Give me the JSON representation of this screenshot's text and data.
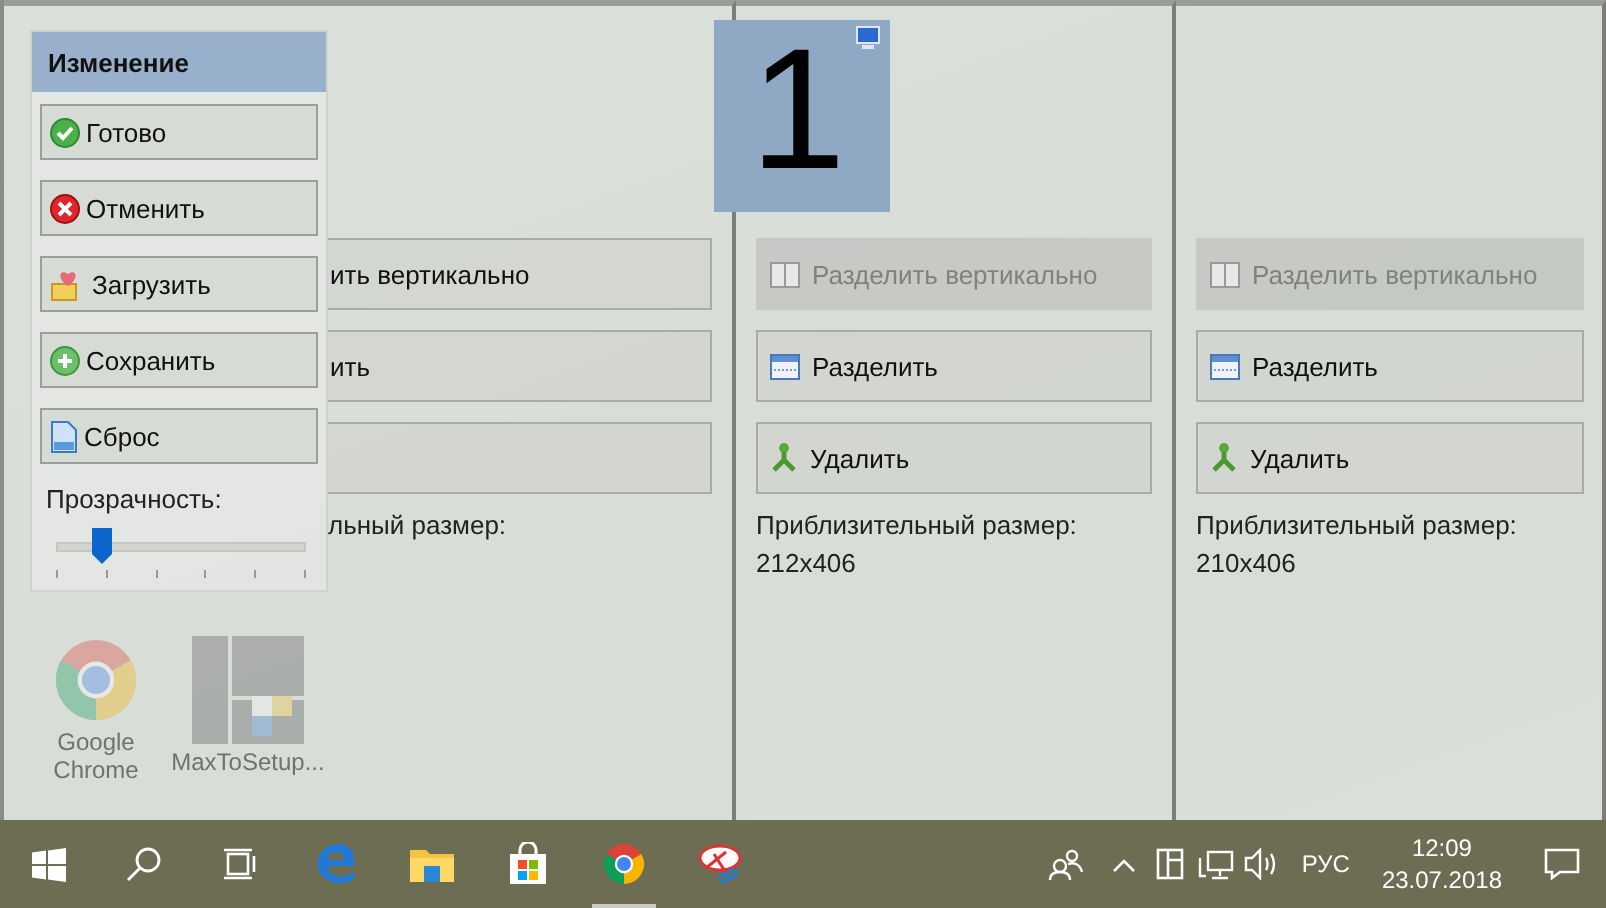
{
  "desktop_icons": [
    {
      "label": "Google Chrome",
      "kind": "chrome"
    },
    {
      "label": "MaxToSetup...",
      "kind": "windows-grid"
    }
  ],
  "panes": [
    {
      "covered": true,
      "buttons": [
        {
          "label": "ить вертикально",
          "kind": "split-vertical",
          "disabled": false
        },
        {
          "label": "ить",
          "kind": "split",
          "disabled": false
        },
        {
          "kind": "delete",
          "disabled": false
        }
      ],
      "size_label": "льный размер:"
    },
    {
      "covered": false,
      "buttons": [
        {
          "label": "Разделить вертикально",
          "kind": "split-vertical",
          "disabled": true
        },
        {
          "label": "Разделить",
          "kind": "split",
          "disabled": false
        },
        {
          "label": "Удалить",
          "kind": "delete",
          "disabled": false
        }
      ],
      "size_label": "Приблизительный размер:",
      "size": "212x406"
    },
    {
      "covered": false,
      "buttons": [
        {
          "label": "Разделить вертикально",
          "kind": "split-vertical",
          "disabled": true
        },
        {
          "label": "Разделить",
          "kind": "split",
          "disabled": false
        },
        {
          "label": "Удалить",
          "kind": "delete",
          "disabled": false
        }
      ],
      "size_label": "Приблизительный размер:",
      "size": "210x406"
    }
  ],
  "monitor_badge": {
    "number": "1"
  },
  "edit_panel": {
    "title": "Изменение",
    "buttons": [
      {
        "label": "Готово",
        "kind": "done"
      },
      {
        "label": "Отменить",
        "kind": "cancel"
      },
      {
        "label": "Загрузить",
        "kind": "load"
      },
      {
        "label": "Сохранить",
        "kind": "save"
      },
      {
        "label": "Сброс",
        "kind": "reset"
      }
    ],
    "opacity_label": "Прозрачность:",
    "opacity": {
      "level": 0.18
    }
  },
  "taskbar": {
    "apps": [
      {
        "kind": "edge",
        "running": false
      },
      {
        "kind": "explorer",
        "running": false
      },
      {
        "kind": "store",
        "running": false
      },
      {
        "kind": "chrome",
        "running": true
      },
      {
        "kind": "snipping",
        "running": false
      }
    ],
    "tray": {
      "language": "РУС",
      "time": "12:09",
      "date": "23.07.2018"
    }
  }
}
